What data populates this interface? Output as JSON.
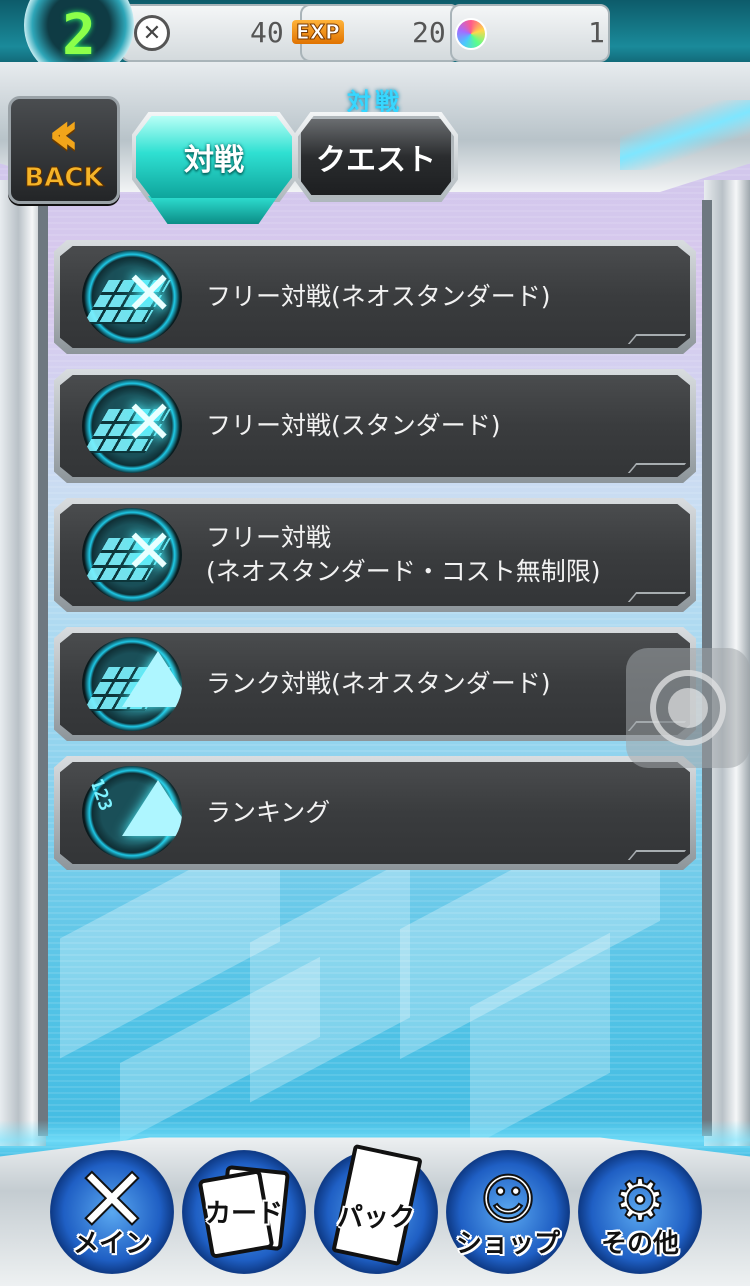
{
  "status_bar": {
    "level": "2",
    "battle_points_icon": "crossed-swords-icon",
    "battle_points": "40",
    "exp_label": "EXP",
    "exp_value": "20",
    "gem_icon": "rainbow-gem-icon",
    "gems": "1"
  },
  "header": {
    "section_title": "対戦",
    "back_button_label": "BACK",
    "back_icon": "double-chevron-left-icon",
    "tabs": [
      {
        "label": "対戦",
        "active": true
      },
      {
        "label": "クエスト",
        "active": false
      }
    ]
  },
  "menu": {
    "items": [
      {
        "label_line1": "フリー対戦(ネオスタンダード)",
        "label_line2": "",
        "icon": "free-battle-icon"
      },
      {
        "label_line1": "フリー対戦(スタンダード)",
        "label_line2": "",
        "icon": "free-battle-icon"
      },
      {
        "label_line1": "フリー対戦",
        "label_line2": "(ネオスタンダード・コスト無制限)",
        "icon": "free-battle-icon"
      },
      {
        "label_line1": "ランク対戦(ネオスタンダード)",
        "label_line2": "",
        "icon": "rank-battle-icon"
      },
      {
        "label_line1": "ランキング",
        "label_line2": "",
        "icon": "ranking-icon"
      }
    ]
  },
  "bottom_nav": {
    "items": [
      {
        "label": "メイン",
        "icon": "main-x-icon"
      },
      {
        "label": "カード",
        "icon": "cards-icon"
      },
      {
        "label": "パック",
        "icon": "pack-icon"
      },
      {
        "label": "ショップ",
        "icon": "shopkeeper-icon"
      },
      {
        "label": "その他",
        "icon": "gear-icon"
      }
    ]
  },
  "colors": {
    "accent_cyan": "#2fe0d2",
    "title_cyan": "#37d7ff",
    "back_orange": "#f2a51a",
    "menu_item_bg": "#3a3c3e",
    "nav_blue": "#1f5fc4"
  }
}
